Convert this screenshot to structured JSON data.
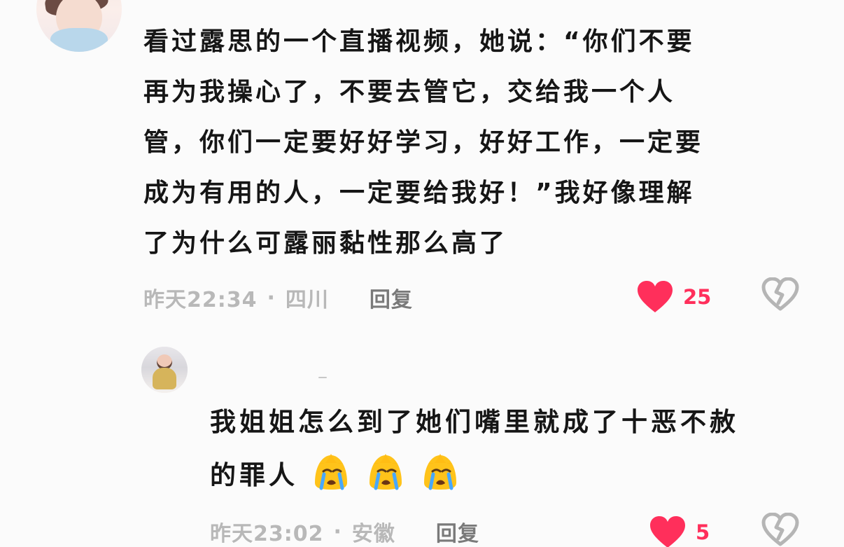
{
  "comments": [
    {
      "avatar_icon": "woman-portrait-avatar",
      "text_lines": [
        "看过露思的一个直播视频，她说：“你们不要",
        "再为我操心了，不要去管它，交给我一个人",
        "管，你们一定要好好学习，好好工作，一定要",
        "成为有用的人，一定要给我好！”我好像理解",
        "了为什么可露丽黏性那么高了"
      ],
      "time": "昨天22:34",
      "separator": "·",
      "location": "四川",
      "reply_label": "回复",
      "likes": "25",
      "like_icon": "heart-filled-icon",
      "dislike_icon": "broken-heart-icon"
    },
    {
      "avatar_icon": "small-photo-avatar",
      "text_lines": [
        "我姐姐怎么到了她们嘴里就成了十恶不赦",
        "的罪人"
      ],
      "emojis": [
        "crying-face-emoji",
        "crying-face-emoji",
        "crying-face-emoji"
      ],
      "time": "昨天23:02",
      "separator": "·",
      "location": "安徽",
      "reply_label": "回复",
      "likes": "5",
      "like_icon": "heart-filled-icon",
      "dislike_icon": "broken-heart-icon"
    }
  ],
  "colors": {
    "background": "#fbfbfb",
    "text": "#161616",
    "meta": "#b8b8b8",
    "reply": "#7a7a7a",
    "like": "#ff2f5b",
    "dislike": "#b5b5b5",
    "emoji": "#ffc31a"
  }
}
